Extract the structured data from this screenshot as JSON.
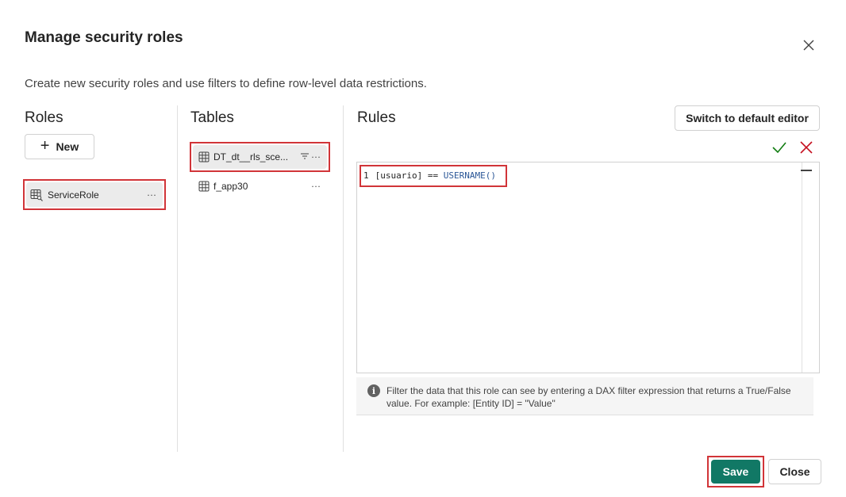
{
  "dialog": {
    "title": "Manage security roles",
    "subtitle": "Create new security roles and use filters to define row-level data restrictions."
  },
  "roles": {
    "heading": "Roles",
    "new_label": "New",
    "items": [
      {
        "label": "ServiceRole",
        "more": "···"
      }
    ]
  },
  "tables": {
    "heading": "Tables",
    "items": [
      {
        "label": "DT_dt__rls_sce...",
        "more": "···",
        "has_filter": true
      },
      {
        "label": "f_app30",
        "more": "···",
        "has_filter": false
      }
    ]
  },
  "rules": {
    "heading": "Rules",
    "switch_label": "Switch to default editor",
    "code": {
      "line_number": "1",
      "expression_left": "[usuario] == ",
      "expression_function": "USERNAME()"
    },
    "info_text": "Filter the data that this role can see by entering a DAX filter expression that returns a True/False value. For example: [Entity ID] = \"Value\""
  },
  "footer": {
    "save_label": "Save",
    "close_label": "Close"
  },
  "colors": {
    "primary": "#117865",
    "highlight": "#d13438",
    "confirm": "#107c10",
    "cancel": "#c50f1f"
  }
}
